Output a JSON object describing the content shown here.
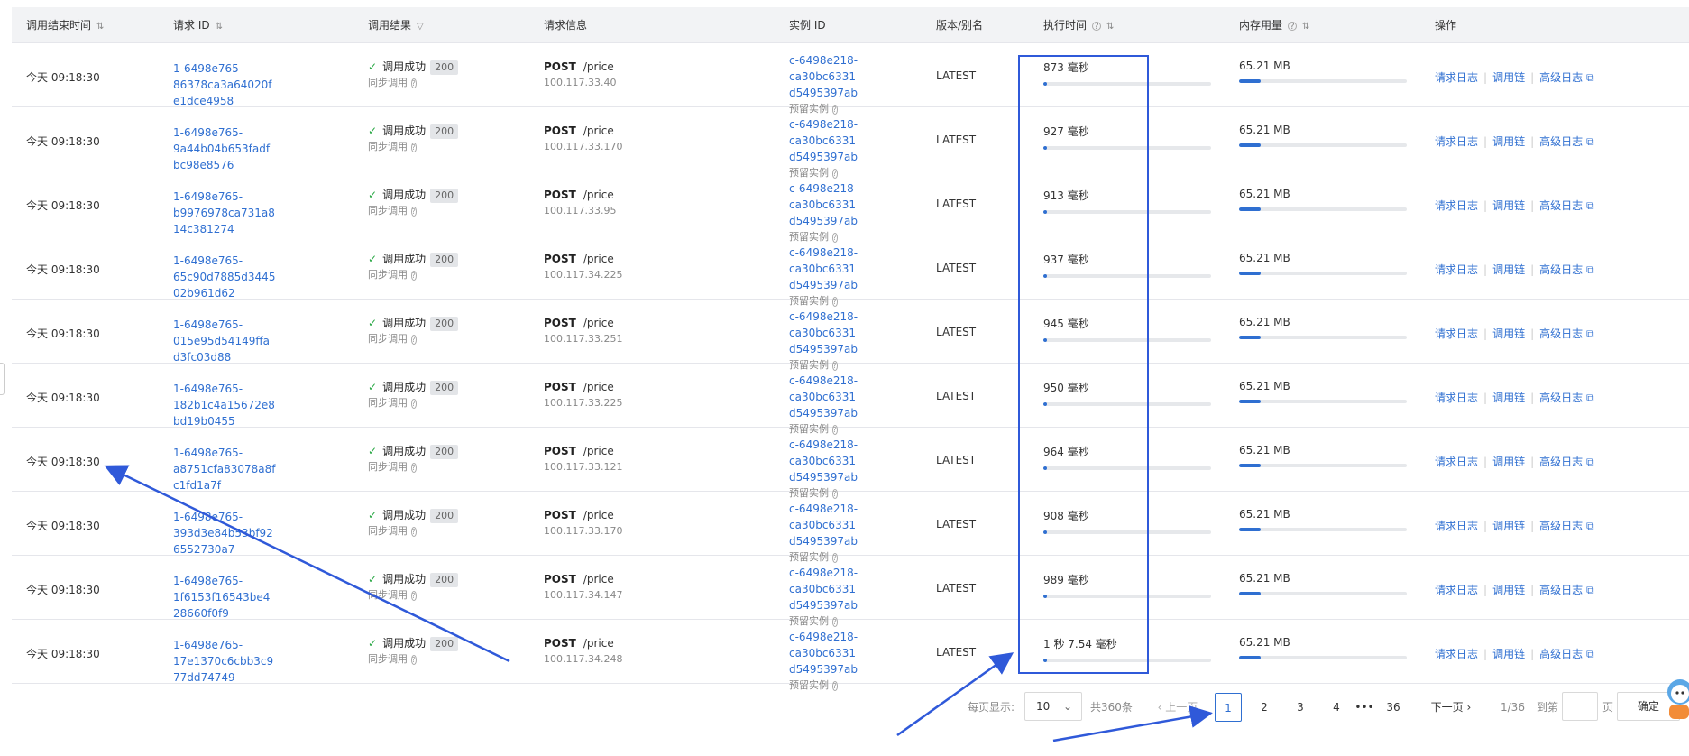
{
  "headers": {
    "end_time": "调用结束时间",
    "request_id": "请求 ID",
    "result": "调用结果",
    "request_info": "请求信息",
    "instance_id": "实例 ID",
    "version": "版本/别名",
    "exec_time": "执行时间",
    "memory": "内存用量",
    "ops": "操作"
  },
  "icons": {
    "sort": "sort-icon",
    "filter": "filter-icon",
    "help": "question-circle-icon",
    "check": "check-icon",
    "external": "external-link-icon"
  },
  "colors": {
    "link": "#2f6fd1",
    "success": "#2aa845",
    "annotation": "#2f59d9"
  },
  "rows": [
    {
      "time": "今天 09:18:30",
      "req_id_1": "1-6498e765-86378ca3a64020f",
      "req_id_2": "e1dce4958",
      "result": "调用成功",
      "code": "200",
      "mode": "同步调用",
      "method": "POST",
      "path": "/price",
      "ip": "100.117.33.40",
      "inst_1": "c-6498e218-ca30bc6331",
      "inst_2": "d5495397ab",
      "inst_type": "预留实例",
      "version": "LATEST",
      "exec": "873 毫秒",
      "exec_pct": 2,
      "mem": "65.21 MB",
      "mem_pct": 13
    },
    {
      "time": "今天 09:18:30",
      "req_id_1": "1-6498e765-9a44b04b653fadf",
      "req_id_2": "bc98e8576",
      "result": "调用成功",
      "code": "200",
      "mode": "同步调用",
      "method": "POST",
      "path": "/price",
      "ip": "100.117.33.170",
      "inst_1": "c-6498e218-ca30bc6331",
      "inst_2": "d5495397ab",
      "inst_type": "预留实例",
      "version": "LATEST",
      "exec": "927 毫秒",
      "exec_pct": 2,
      "mem": "65.21 MB",
      "mem_pct": 13
    },
    {
      "time": "今天 09:18:30",
      "req_id_1": "1-6498e765-b9976978ca731a8",
      "req_id_2": "14c381274",
      "result": "调用成功",
      "code": "200",
      "mode": "同步调用",
      "method": "POST",
      "path": "/price",
      "ip": "100.117.33.95",
      "inst_1": "c-6498e218-ca30bc6331",
      "inst_2": "d5495397ab",
      "inst_type": "预留实例",
      "version": "LATEST",
      "exec": "913 毫秒",
      "exec_pct": 2,
      "mem": "65.21 MB",
      "mem_pct": 13
    },
    {
      "time": "今天 09:18:30",
      "req_id_1": "1-6498e765-65c90d7885d3445",
      "req_id_2": "02b961d62",
      "result": "调用成功",
      "code": "200",
      "mode": "同步调用",
      "method": "POST",
      "path": "/price",
      "ip": "100.117.34.225",
      "inst_1": "c-6498e218-ca30bc6331",
      "inst_2": "d5495397ab",
      "inst_type": "预留实例",
      "version": "LATEST",
      "exec": "937 毫秒",
      "exec_pct": 2,
      "mem": "65.21 MB",
      "mem_pct": 13
    },
    {
      "time": "今天 09:18:30",
      "req_id_1": "1-6498e765-015e95d54149ffa",
      "req_id_2": "d3fc03d88",
      "result": "调用成功",
      "code": "200",
      "mode": "同步调用",
      "method": "POST",
      "path": "/price",
      "ip": "100.117.33.251",
      "inst_1": "c-6498e218-ca30bc6331",
      "inst_2": "d5495397ab",
      "inst_type": "预留实例",
      "version": "LATEST",
      "exec": "945 毫秒",
      "exec_pct": 2,
      "mem": "65.21 MB",
      "mem_pct": 13
    },
    {
      "time": "今天 09:18:30",
      "req_id_1": "1-6498e765-182b1c4a15672e8",
      "req_id_2": "bd19b0455",
      "result": "调用成功",
      "code": "200",
      "mode": "同步调用",
      "method": "POST",
      "path": "/price",
      "ip": "100.117.33.225",
      "inst_1": "c-6498e218-ca30bc6331",
      "inst_2": "d5495397ab",
      "inst_type": "预留实例",
      "version": "LATEST",
      "exec": "950 毫秒",
      "exec_pct": 2,
      "mem": "65.21 MB",
      "mem_pct": 13
    },
    {
      "time": "今天 09:18:30",
      "req_id_1": "1-6498e765-a8751cfa83078a8f",
      "req_id_2": "c1fd1a7f",
      "result": "调用成功",
      "code": "200",
      "mode": "同步调用",
      "method": "POST",
      "path": "/price",
      "ip": "100.117.33.121",
      "inst_1": "c-6498e218-ca30bc6331",
      "inst_2": "d5495397ab",
      "inst_type": "预留实例",
      "version": "LATEST",
      "exec": "964 毫秒",
      "exec_pct": 2,
      "mem": "65.21 MB",
      "mem_pct": 13
    },
    {
      "time": "今天 09:18:30",
      "req_id_1": "1-6498e765-393d3e84b53bf92",
      "req_id_2": "6552730a7",
      "result": "调用成功",
      "code": "200",
      "mode": "同步调用",
      "method": "POST",
      "path": "/price",
      "ip": "100.117.33.170",
      "inst_1": "c-6498e218-ca30bc6331",
      "inst_2": "d5495397ab",
      "inst_type": "预留实例",
      "version": "LATEST",
      "exec": "908 毫秒",
      "exec_pct": 2,
      "mem": "65.21 MB",
      "mem_pct": 13
    },
    {
      "time": "今天 09:18:30",
      "req_id_1": "1-6498e765-1f6153f16543be4",
      "req_id_2": "28660f0f9",
      "result": "调用成功",
      "code": "200",
      "mode": "同步调用",
      "method": "POST",
      "path": "/price",
      "ip": "100.117.34.147",
      "inst_1": "c-6498e218-ca30bc6331",
      "inst_2": "d5495397ab",
      "inst_type": "预留实例",
      "version": "LATEST",
      "exec": "989 毫秒",
      "exec_pct": 2,
      "mem": "65.21 MB",
      "mem_pct": 13
    },
    {
      "time": "今天 09:18:30",
      "req_id_1": "1-6498e765-17e1370c6cbb3c9",
      "req_id_2": "77dd74749",
      "result": "调用成功",
      "code": "200",
      "mode": "同步调用",
      "method": "POST",
      "path": "/price",
      "ip": "100.117.34.248",
      "inst_1": "c-6498e218-ca30bc6331",
      "inst_2": "d5495397ab",
      "inst_type": "预留实例",
      "version": "LATEST",
      "exec": "1 秒 7.54 毫秒",
      "exec_pct": 2,
      "mem": "65.21 MB",
      "mem_pct": 13
    }
  ],
  "ops": {
    "req_log": "请求日志",
    "trace": "调用链",
    "adv_log": "高级日志"
  },
  "pagination": {
    "per_page_label": "每页显示:",
    "per_page_value": "10",
    "total": "共360条",
    "prev": "上一页",
    "pages": [
      "1",
      "2",
      "3",
      "4"
    ],
    "ellipsis": "•••",
    "last": "36",
    "next": "下一页",
    "page_of": "1/36",
    "goto": "到第",
    "page_unit": "页",
    "confirm": "确定"
  }
}
